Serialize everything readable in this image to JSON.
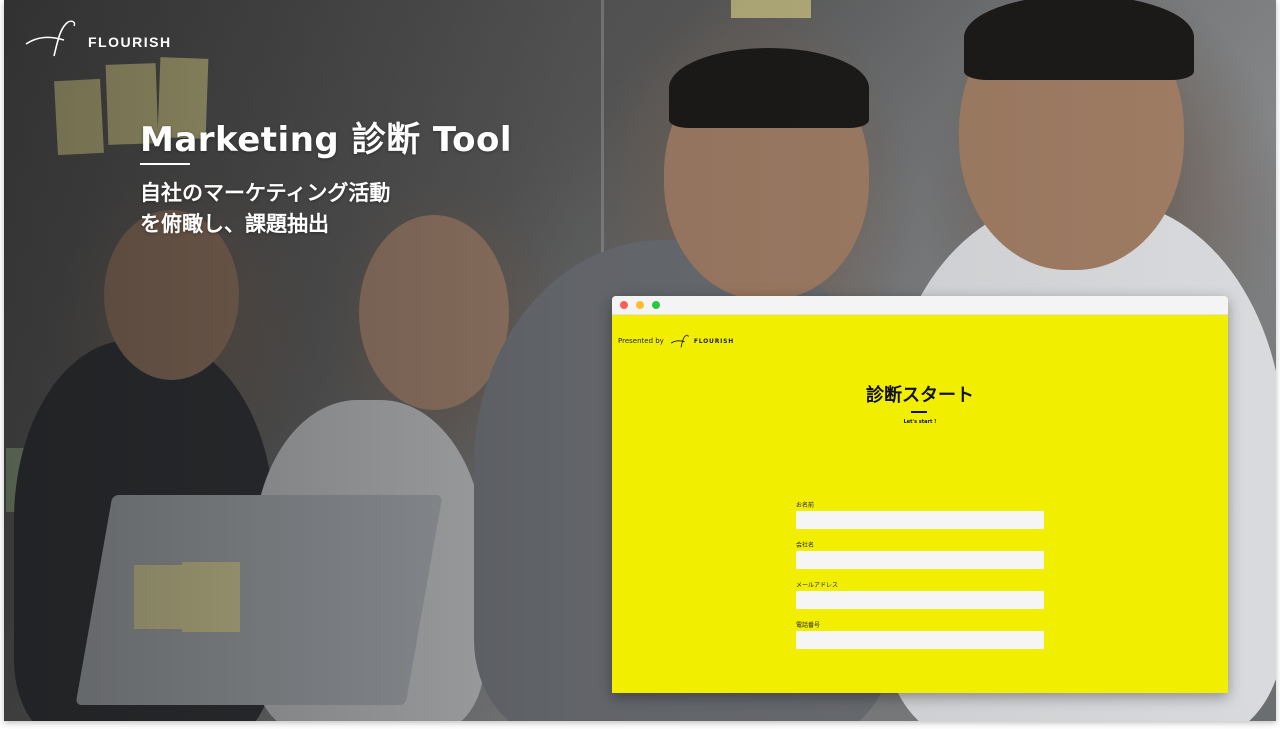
{
  "brand": {
    "name": "FLOURISH"
  },
  "hero": {
    "title": "Marketing 診断 Tool",
    "subtitle_line1": "自社のマーケティング活動",
    "subtitle_line2": "を俯瞰し、課題抽出"
  },
  "window": {
    "presented_by": "Presented by",
    "logo_text": "FLOURISH",
    "title": "診断スタート",
    "subtitle": "Let's start !",
    "controls": {
      "close_color": "#ff5f57",
      "minimize_color": "#febc2e",
      "zoom_color": "#28c840"
    },
    "background_color": "#f2ee00",
    "form": {
      "fields": [
        {
          "label": "お名前",
          "value": ""
        },
        {
          "label": "会社名",
          "value": ""
        },
        {
          "label": "メールアドレス",
          "value": ""
        },
        {
          "label": "電話番号",
          "value": ""
        }
      ]
    }
  }
}
